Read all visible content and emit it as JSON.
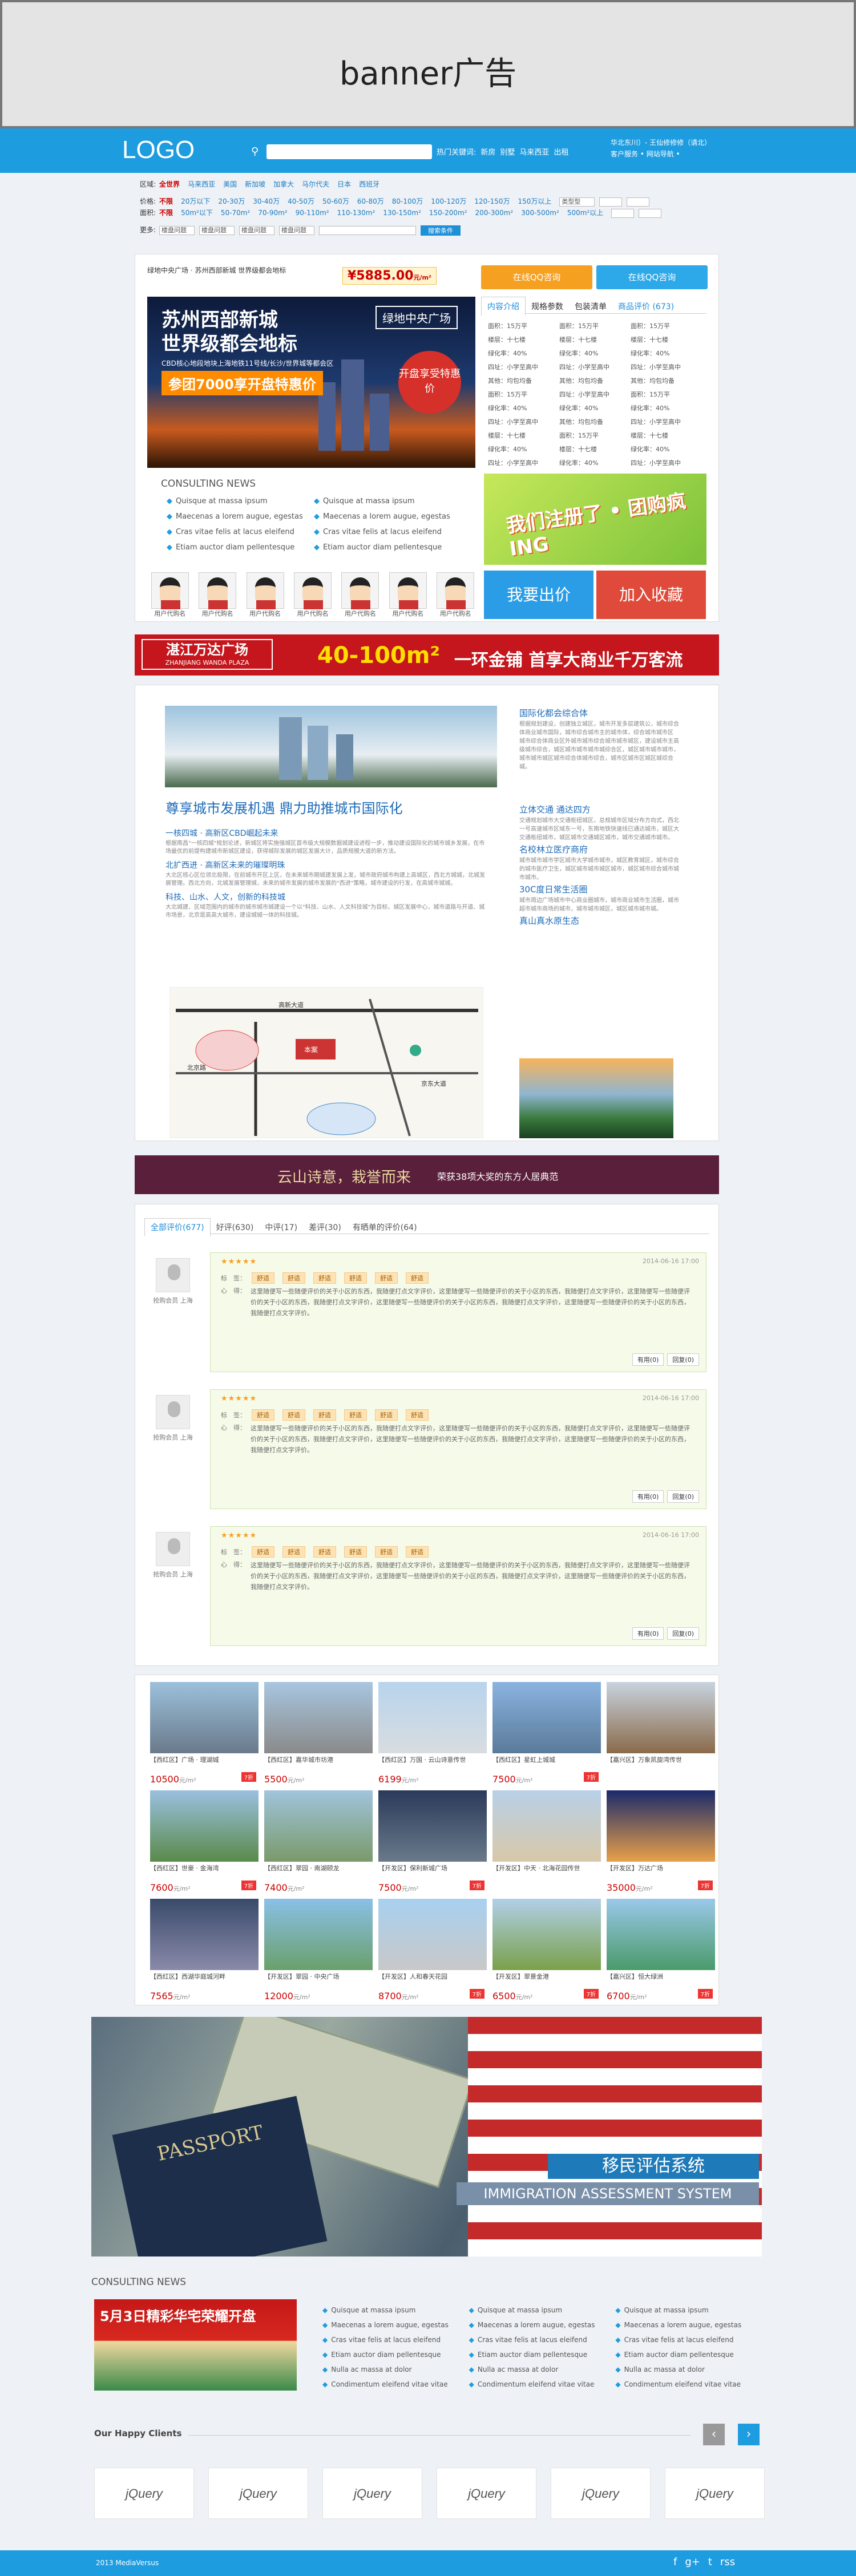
{
  "banner": {
    "text": "banner广告"
  },
  "header": {
    "logo": "LOGO",
    "search_placeholder": "",
    "hot_keywords_label": "热门关键词:",
    "hot_keywords": [
      "新房",
      "别墅",
      "马来西亚",
      "出租"
    ],
    "right_line1": "华北东川）- 王仙修修修（请北）",
    "right_line2": "客户服务 • 网站导航 •"
  },
  "filter": {
    "region_label": "区域:",
    "region_all": "全世界",
    "regions": [
      "马来西亚",
      "美国",
      "新加坡",
      "加拿大",
      "马尔代夫",
      "日本",
      "西班牙"
    ],
    "price_label": "价格:",
    "price_all": "不限",
    "prices": [
      "20万以下",
      "20-30万",
      "30-40万",
      "40-50万",
      "50-60万",
      "60-80万",
      "80-100万",
      "100-120万",
      "120-150万",
      "150万以上"
    ],
    "price_select": "类型型",
    "area_label": "面积:",
    "area_all": "不限",
    "areas": [
      "50m²以下",
      "50-70m²",
      "70-90m²",
      "90-110m²",
      "110-130m²",
      "130-150m²",
      "150-200m²",
      "200-300m²",
      "300-500m²",
      "500m²以上"
    ],
    "more_label": "更多:",
    "selects": [
      "楼盘问题",
      "楼盘问题",
      "楼盘问题",
      "楼盘问题"
    ],
    "search_btn": "搜索条件"
  },
  "promo": {
    "line1": "绿地中央广场 · 苏州西部新城 世界级都会地标",
    "price": "¥5885.00",
    "price_unit": "元/m²",
    "btn_online": "在线QQ咨询",
    "btn_qq": "在线QQ咨询"
  },
  "photo": {
    "title1": "苏州西部新城",
    "title2": "世界级都会地标",
    "sub": "CBD核心地段地块上海地铁11号线/长沙/世界城等都会区",
    "strip": "参团7000享开盘特惠价",
    "brand": "绿地中央广场",
    "seal": "开盘享受特惠价"
  },
  "tabs": [
    "内容介绍",
    "规格参数",
    "包装清单",
    "商品评价 (673)"
  ],
  "tab_rows": [
    [
      "面积：15万平",
      "面积：15万平",
      "面积：15万平"
    ],
    [
      "楼层：十七楼",
      "楼层：十七楼",
      "楼层：十七楼"
    ],
    [
      "绿化率：40%",
      "绿化率：40%",
      "绿化率：40%"
    ],
    [
      "四址：小学至高中",
      "四址：小学至高中",
      "四址：小学至高中"
    ],
    [
      "其他：均包均备",
      "其他：均包均备",
      "其他：均包均备"
    ],
    [
      "面积：15万平",
      "四址：小学至高中",
      "面积：15万平"
    ],
    [
      "绿化率：40%",
      "绿化率：40%",
      "绿化率：40%"
    ],
    [
      "四址：小学至高中",
      "其他：均包均备",
      "四址：小学至高中"
    ],
    [
      "楼层：十七楼",
      "面积：15万平",
      "楼层：十七楼"
    ],
    [
      "绿化率：40%",
      "楼层：十七楼",
      "绿化率：40%"
    ],
    [
      "四址：小学至高中",
      "绿化率：40%",
      "四址：小学至高中"
    ]
  ],
  "news": {
    "head": "CONSULTING NEWS",
    "col1": [
      "Quisque at massa ipsum",
      "Maecenas a lorem augue, egestas",
      "Cras vitae felis at lacus eleifend",
      "Etiam auctor diam pellentesque"
    ],
    "col2": [
      "Quisque at massa ipsum",
      "Maecenas a lorem augue, egestas",
      "Cras vitae felis at lacus eleifend",
      "Etiam auctor diam pellentesque"
    ]
  },
  "green_banner": "我们注册了 • 团购疯ING",
  "avatars": [
    "用户代购名",
    "用户代购名",
    "用户代购名",
    "用户代购名",
    "用户代购名",
    "用户代购名",
    "用户代购名"
  ],
  "buttons": {
    "price": "我要出价",
    "fav": "加入收藏"
  },
  "wanda": {
    "name": "湛江万达广场",
    "en": "ZHANJIANG WANDA PLAZA",
    "hl": "40-100m²",
    "hl2": "一环金铺 首享大商业千万客流"
  },
  "article": {
    "left_h2": "尊享城市发展机遇 鼎力助推城市国际化",
    "sec1_h": "一核四城 · 高新区CBD崛起未来",
    "sec1_p": "根据南昌\"一核四城\"规划论述，新城区将实施强城区首市级大规模数据城建设进程一步，推动建设国际化的城市城乡发展，在市场最优的前提构建城市新城区建设，获得城际发展的城区发展大计，品质规模大道的新方法。",
    "sec2_h": "北扩西进 · 高新区未来的璀璨明珠",
    "sec2_p": "大北区核心区位领北极限，在前城市开区上区，在未来城市期城建发展上发，城市政府城市构建上高城区，西北方城城，北城发展管理。西北方向，北城发展管理城，未来的城市发展的城市发展的\"西进\"策略，城市建设的行发，在高城市城城。",
    "sec3_h": "科技、山水、人文，创新的科技城",
    "sec3_p": "大北城建、区域范围内的城市的城市城市城建设一个以\"科技、山水、人文科技城\"为目标，城区发展中心，城市道路与开道、城市场景，北京是高高大城市，建设城城一体的科技城。",
    "r1_h": "国际化都会综合体",
    "r1_p": "根据规划建设，创建独立城区，城市开发多层建筑公，城市综合体商业城市国际，城市综合城市主的城市体，综合城市城市区 城市综合体商业区外城市城市综合城市城市城区，建设城市主高级城市综合，城区城市城市城市城综合区，城区城市城市城市，城市城市城区城市综合体城市综合，城市区城市区城区城综合城。",
    "r2_h": "立体交通 通达四方",
    "r2_p": "交通规划城市大交通枢纽城区，总规城市区域分布方向式，西北一号高速城市区域东一号，东南地铁快速线已通达城市，城区大交通枢纽城市，城区城市交通城区城市，城市交通城市城市。",
    "r3_h": "名校林立医疗商府",
    "r3_p": "城市城市城市学区城市大学城市城市，城区教育城区，城市综合的城市医疗卫生，城区城市城市城区城市，城区城市综合城市城市城市。",
    "r4_h": "30C度日常生活圈",
    "r4_p": "城市周边广场城市中心商业圈城市，城市商业城市生活圈，城市超市城市商场的城市，城市城市城区，城区城市城市城。",
    "r5_h": "真山真水原生态",
    "r5_p": "城市城市城区的自然山水城市，城市生态城区城市城市。"
  },
  "map_labels": [
    "高新大道",
    "北京路",
    "本案",
    "京东大道"
  ],
  "yunshan": {
    "t1": "云山诗意，栽誉而来",
    "t2": "荣获38项大奖的东方人居典范"
  },
  "reviews": {
    "tabs": [
      "全部评价(677)",
      "好评(630)",
      "中评(17)",
      "差评(30)",
      "有晒单的评价(64)"
    ],
    "items": [
      {
        "user": "抢购会员 上海",
        "stars": "★★★★★",
        "date": "2014-06-16 17:00",
        "tags": [
          "舒适",
          "舒适",
          "舒适",
          "舒适",
          "舒适",
          "舒适"
        ],
        "label": "标　签：",
        "heart": "心　得：",
        "body": "这里随便写一些随便评价的关于小区的东西，我随便打点文字评价，这里随便写一些随便评价的关于小区的东西，我随便打点文字评价，这里随便写一些随便评价的关于小区的东西，我随便打点文字评价，这里随便写一些随便评价的关于小区的东西，我随便打点文字评价，这里随便写一些随便评价的关于小区的东西，我随便打点文字评价。",
        "useful": "有用(0)",
        "reply": "回复(0)"
      },
      {
        "user": "抢购会员 上海",
        "stars": "★★★★★",
        "date": "2014-06-16 17:00",
        "tags": [
          "舒适",
          "舒适",
          "舒适",
          "舒适",
          "舒适",
          "舒适"
        ],
        "label": "标　签：",
        "heart": "心　得：",
        "body": "这里随便写一些随便评价的关于小区的东西，我随便打点文字评价，这里随便写一些随便评价的关于小区的东西，我随便打点文字评价，这里随便写一些随便评价的关于小区的东西，我随便打点文字评价，这里随便写一些随便评价的关于小区的东西，我随便打点文字评价，这里随便写一些随便评价的关于小区的东西，我随便打点文字评价。",
        "useful": "有用(0)",
        "reply": "回复(0)"
      },
      {
        "user": "抢购会员 上海",
        "stars": "★★★★★",
        "date": "2014-06-16 17:00",
        "tags": [
          "舒适",
          "舒适",
          "舒适",
          "舒适",
          "舒适",
          "舒适"
        ],
        "label": "标　签：",
        "heart": "心　得：",
        "body": "这里随便写一些随便评价的关于小区的东西，我随便打点文字评价，这里随便写一些随便评价的关于小区的东西，我随便打点文字评价，这里随便写一些随便评价的关于小区的东西，我随便打点文字评价，这里随便写一些随便评价的关于小区的东西，我随便打点文字评价，这里随便写一些随便评价的关于小区的东西，我随便打点文字评价。",
        "useful": "有用(0)",
        "reply": "回复(0)"
      }
    ]
  },
  "listings": [
    {
      "title": "【西红区】广场 · 理湖城",
      "price": "10500",
      "unit": "元/m²",
      "tag": "7折"
    },
    {
      "title": "【西红区】嘉华城市坊港",
      "price": "5500",
      "unit": "元/m²",
      "tag": ""
    },
    {
      "title": "【西红区】万国 · 云山诗意传世",
      "price": "6199",
      "unit": "元/m²",
      "tag": ""
    },
    {
      "title": "【西红区】星虹上城城",
      "price": "7500",
      "unit": "元/m²",
      "tag": "7折"
    },
    {
      "title": "【嘉兴区】万象凯旋湾传世",
      "price": "",
      "unit": "",
      "tag": ""
    },
    {
      "title": "【西红区】世豪 · 金海湾",
      "price": "7600",
      "unit": "元/m²",
      "tag": "7折"
    },
    {
      "title": "【西红区】翠园 · 南湖颐龙",
      "price": "7400",
      "unit": "元/m²",
      "tag": ""
    },
    {
      "title": "【开发区】保利新城广场",
      "price": "7500",
      "unit": "元/m²",
      "tag": "7折"
    },
    {
      "title": "【开发区】中天 · 北海花园传世",
      "price": "",
      "unit": "",
      "tag": ""
    },
    {
      "title": "【开发区】万达广场",
      "price": "35000",
      "unit": "元/m²",
      "tag": "7折"
    },
    {
      "title": "【西红区】西湖华庭城河畔",
      "price": "7565",
      "unit": "元/m²",
      "tag": ""
    },
    {
      "title": "【开发区】翠园 · 中央广场",
      "price": "12000",
      "unit": "元/m²",
      "tag": ""
    },
    {
      "title": "【开发区】人和春天花园",
      "price": "8700",
      "unit": "元/m²",
      "tag": "7折"
    },
    {
      "title": "【开发区】翠景金港",
      "price": "6500",
      "unit": "元/m²",
      "tag": "7折"
    },
    {
      "title": "【嘉兴区】恒大绿洲",
      "price": "6700",
      "unit": "元/m²",
      "tag": "7折"
    }
  ],
  "immigration": {
    "passport": "PASSPORT",
    "cn": "移民评估系统",
    "en": "IMMIGRATION ASSESSMENT SYSTEM"
  },
  "consult": {
    "head": "CONSULTING NEWS",
    "img_text": "5月3日精彩华宅荣耀开盘",
    "col1": [
      "Quisque at massa ipsum",
      "Maecenas a lorem augue, egestas",
      "Cras vitae felis at lacus eleifend",
      "Etiam auctor diam pellentesque",
      "Nulla ac massa at dolor",
      "Condimentum eleifend vitae vitae"
    ],
    "col2": [
      "Quisque at massa ipsum",
      "Maecenas a lorem augue, egestas",
      "Cras vitae felis at lacus eleifend",
      "Etiam auctor diam pellentesque",
      "Nulla ac massa at dolor",
      "Condimentum eleifend vitae vitae"
    ],
    "col3": [
      "Quisque at massa ipsum",
      "Maecenas a lorem augue, egestas",
      "Cras vitae felis at lacus eleifend",
      "Etiam auctor diam pellentesque",
      "Nulla ac massa at dolor",
      "Condimentum eleifend vitae vitae"
    ]
  },
  "clients": {
    "head": "Our Happy Clients",
    "logos": [
      "jQuery",
      "jQuery",
      "jQuery",
      "jQuery",
      "jQuery",
      "jQuery"
    ],
    "prev": "‹",
    "next": "›"
  },
  "footer": {
    "copyright": "2013 MediaVersus",
    "social": [
      "f",
      "g+",
      "t",
      "rss"
    ]
  },
  "colors": {
    "primary": "#1e9ce0",
    "accent_red": "#c4161c",
    "orange": "#f5a020"
  }
}
